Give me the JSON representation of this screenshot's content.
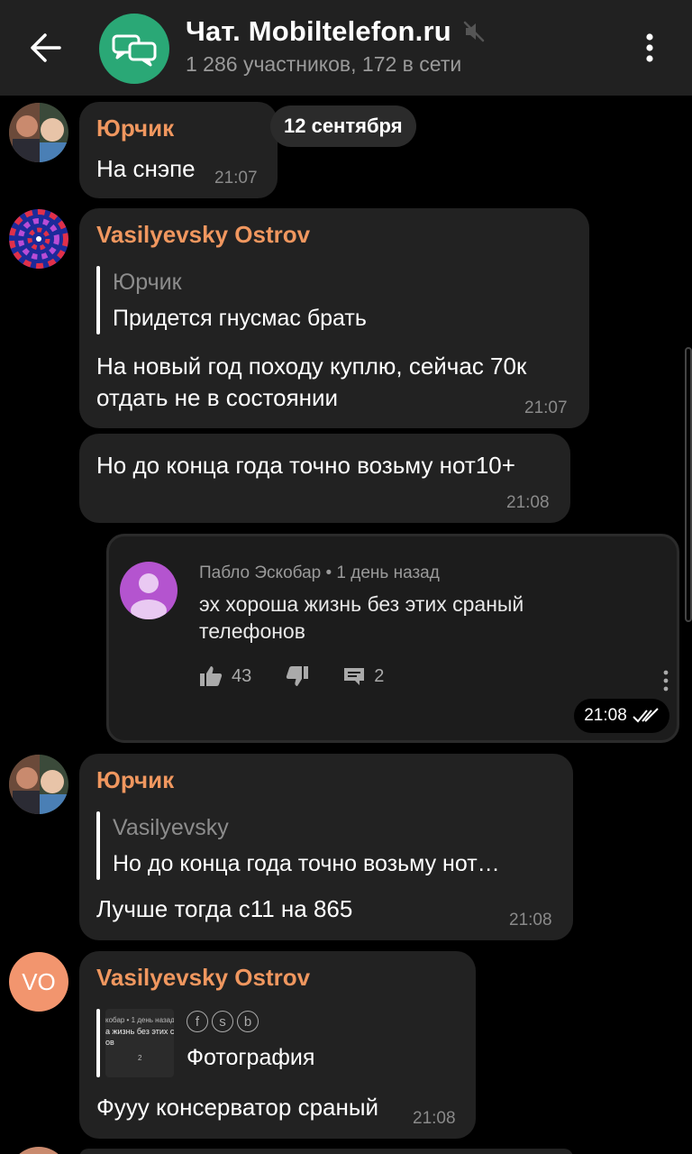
{
  "header": {
    "title": "Чат. Mobiltelefon.ru",
    "subtitle": "1 286 участников, 172 в сети"
  },
  "date_separator": "12 сентября",
  "messages": [
    {
      "author": "Юрчик",
      "text": "На снэпе",
      "time": "21:07"
    },
    {
      "author": "Vasilyevsky Ostrov",
      "reply_author": "Юрчик",
      "reply_text": "Придется гнусмас брать",
      "text_line1": "На новый год походу куплю, сейчас 70к",
      "text_line2": "отдать не в состоянии",
      "time": "21:07"
    },
    {
      "text": "Но до конца года точно возьму нот10+",
      "time": "21:08"
    },
    {
      "embed": {
        "meta": "Пабло Эскобар • 1 день назад",
        "text": "эх хороша жизнь без этих сраный телефонов",
        "likes": "43",
        "comments": "2"
      },
      "time": "21:08"
    },
    {
      "author": "Юрчик",
      "reply_author": "Vasilyevsky",
      "reply_text": "Но до конца года точно возьму нот…",
      "text": "Лучше тогда с11 на 865",
      "time": "21:08"
    },
    {
      "author": "Vasilyevsky Ostrov",
      "avatar_initials": "VO",
      "media_label": "Фотография",
      "thumb_line1": "кобар • 1 день назад",
      "thumb_line2": "а жизнь без этих ср",
      "thumb_line3": "ов",
      "thumb_count": "2",
      "fsb": [
        "f",
        "s",
        "b"
      ],
      "text": "Фууу консерватор сраный",
      "time": "21:08"
    }
  ],
  "colors": {
    "accent_author": "#f0975f",
    "header_bg": "#212121",
    "bubble_bg": "#222222",
    "chat_avatar": "#2aa876",
    "vo_avatar": "#f2956e"
  }
}
